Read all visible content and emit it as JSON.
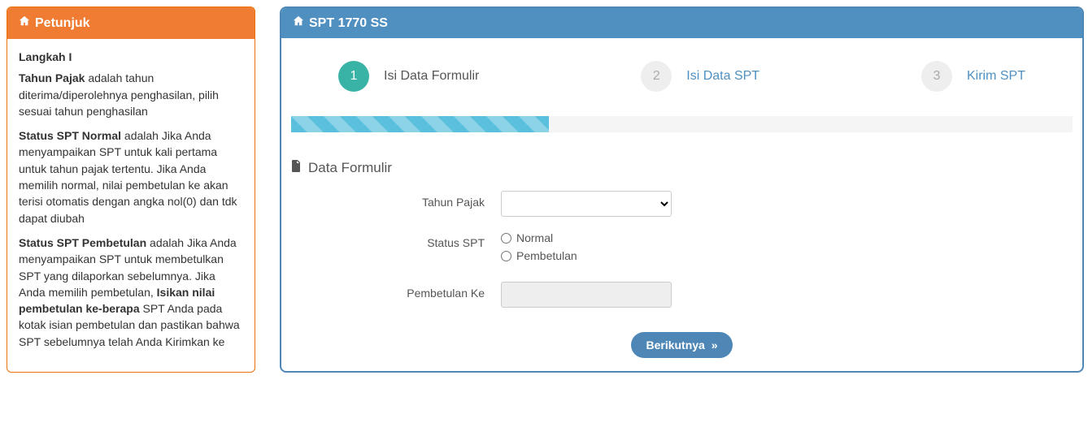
{
  "petunjuk": {
    "title": "Petunjuk",
    "heading": "Langkah I",
    "p1_b": "Tahun Pajak",
    "p1_rest": " adalah tahun diterima/diperolehnya penghasilan, pilih sesuai tahun penghasilan",
    "p2_b": "Status SPT Normal",
    "p2_rest": " adalah Jika Anda menyampaikan SPT untuk kali pertama untuk tahun pajak tertentu. Jika Anda memilih normal, nilai pembetulan ke akan terisi otomatis dengan angka nol(0) dan tdk dapat diubah",
    "p3_b1": "Status SPT Pembetulan",
    "p3_mid1": " adalah Jika Anda menyampaikan SPT untuk membetulkan SPT yang dilaporkan sebelumnya. Jika Anda memilih pembetulan, ",
    "p3_b2": "Isikan nilai pembetulan ke-berapa",
    "p3_mid2": " SPT Anda pada kotak isian pembetulan dan pastikan bahwa SPT sebelumnya telah Anda Kirimkan ke"
  },
  "main": {
    "title": "SPT 1770 SS",
    "steps": [
      {
        "num": "1",
        "label": "Isi Data Formulir",
        "active": true
      },
      {
        "num": "2",
        "label": "Isi Data SPT",
        "active": false
      },
      {
        "num": "3",
        "label": "Kirim SPT",
        "active": false
      }
    ],
    "progress_pct": 33,
    "section_title": "Data Formulir",
    "labels": {
      "tahun_pajak": "Tahun Pajak",
      "status_spt": "Status SPT",
      "normal": "Normal",
      "pembetulan": "Pembetulan",
      "pembetulan_ke": "Pembetulan Ke"
    },
    "button_next": "Berikutnya"
  }
}
